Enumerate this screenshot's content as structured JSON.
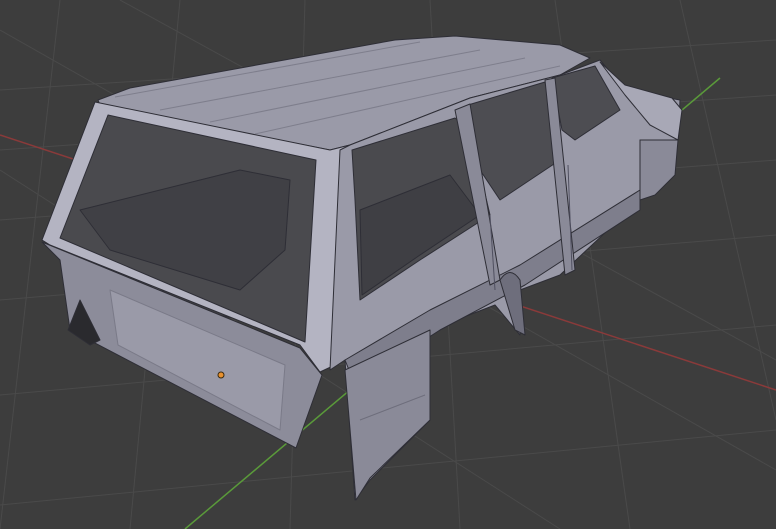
{
  "viewport": {
    "background_color": "#3d3d3d",
    "grid_color": "#4a4a4a",
    "x_axis_color": "#8a3a3a",
    "y_axis_color": "#5a9a3a",
    "origin_color": "#e8912f"
  },
  "model": {
    "body_color": "#9a9aa8",
    "body_light_color": "#b4b4c2",
    "body_dark_color": "#6e6e7c",
    "interior_color": "#4a4a4e",
    "outline_color": "#2e2e36"
  }
}
